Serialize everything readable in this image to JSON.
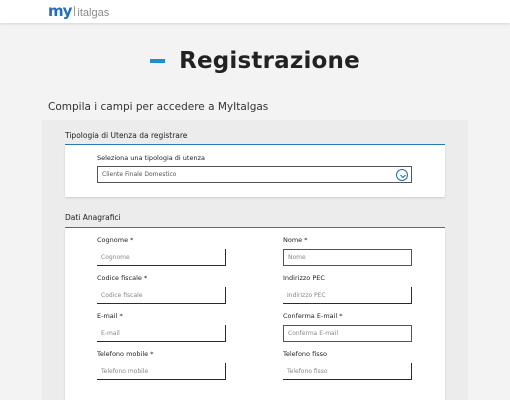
{
  "header": {
    "logo_my": "my",
    "logo_brand": "italgas"
  },
  "page": {
    "title": "Registrazione",
    "subtitle": "Compila i campi per accedere a MyItalgas"
  },
  "section_utenza": {
    "title": "Tipologia di Utenza da registrare",
    "select_label": "Seleziona una tipologia di utenza",
    "select_value": "Cliente Finale Domestico",
    "select_icon": "chevron-down-icon"
  },
  "section_anagrafici": {
    "title": "Dati Anagrafici",
    "fields": {
      "cognome": {
        "label": "Cognome *",
        "placeholder": "Cognome"
      },
      "nome": {
        "label": "Nome *",
        "placeholder": "Nome"
      },
      "codice_fiscale": {
        "label": "Codice fiscale *",
        "placeholder": "Codice fiscale"
      },
      "indirizzo_pec": {
        "label": "Indirizzo PEC",
        "placeholder": "Indirizzo PEC"
      },
      "email": {
        "label": "E-mail *",
        "placeholder": "E-mail"
      },
      "conferma_email": {
        "label": "Conferma E-mail *",
        "placeholder": "Conferma E-mail"
      },
      "telefono_mobile": {
        "label": "Telefono mobile *",
        "placeholder": "Telefono mobile"
      },
      "telefono_fisso": {
        "label": "Telefono fisso",
        "placeholder": "Telefono fisso"
      }
    }
  },
  "colors": {
    "accent": "#1b8fd3",
    "brand_blue": "#1f6fc4",
    "section_line": "#2a79b8"
  }
}
